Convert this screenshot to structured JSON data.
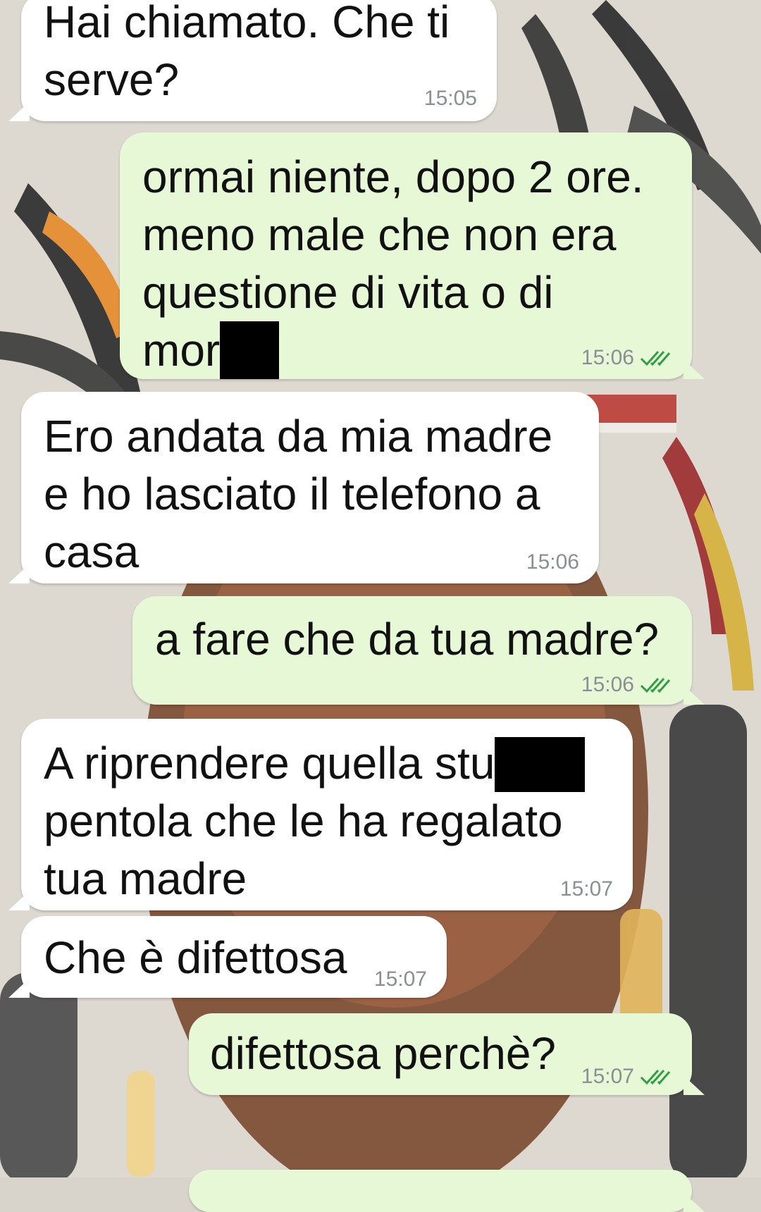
{
  "colors": {
    "incoming_bubble": "#ffffff",
    "outgoing_bubble": "#e6f8d6",
    "timestamp": "#8a8f93",
    "read_ticks": "#2ea043"
  },
  "messages": [
    {
      "direction": "incoming",
      "text": "Hai chiamato. Che ti\nserve?",
      "time": "15:05"
    },
    {
      "direction": "outgoing",
      "text_main": "ormai niente, dopo 2 ore.\nmeno male che non era\nquestione di vita o di\nmor",
      "redacted": true,
      "time": "15:06",
      "status_icon": "double-check-icon"
    },
    {
      "direction": "incoming",
      "text": "Ero andata da mia madre\ne ho lasciato il telefono a\ncasa",
      "time": "15:06"
    },
    {
      "direction": "outgoing",
      "text": "a fare che da tua madre?",
      "time": "15:06",
      "status_icon": "double-check-icon"
    },
    {
      "direction": "incoming",
      "text_main": "A riprendere quella stu",
      "redacted": true,
      "text_rest": "pentola che le ha regalato\ntua madre",
      "time": "15:07"
    },
    {
      "direction": "incoming",
      "text": "Che è difettosa",
      "time": "15:07"
    },
    {
      "direction": "outgoing",
      "text": "difettosa perchè?",
      "time": "15:07",
      "status_icon": "double-check-icon"
    }
  ]
}
